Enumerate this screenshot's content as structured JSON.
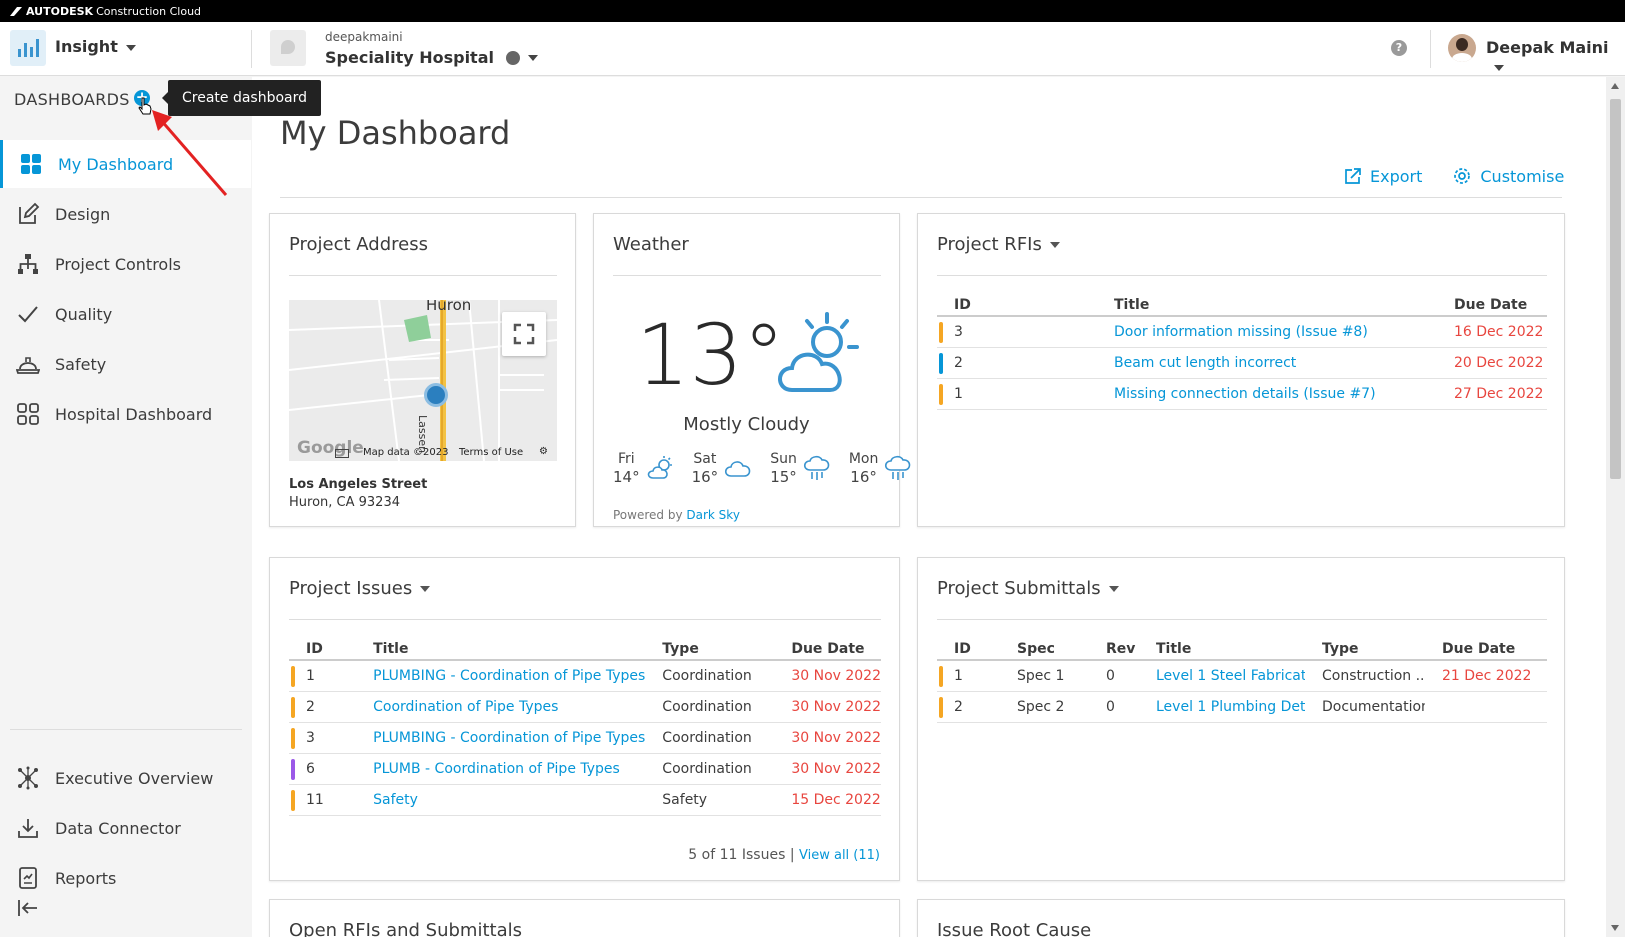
{
  "brand": {
    "company": "AUTODESK",
    "product": "Construction Cloud"
  },
  "app": {
    "name": "Insight"
  },
  "project": {
    "account": "deepakmaini",
    "name": "Speciality Hospital"
  },
  "user": {
    "name": "Deepak Maini"
  },
  "sidebar": {
    "header": "DASHBOARDS",
    "tooltip": "Create dashboard",
    "items": [
      {
        "label": "My Dashboard",
        "icon": "grid-icon"
      },
      {
        "label": "Design",
        "icon": "edit-icon"
      },
      {
        "label": "Project Controls",
        "icon": "hierarchy-icon"
      },
      {
        "label": "Quality",
        "icon": "check-icon"
      },
      {
        "label": "Safety",
        "icon": "hardhat-icon"
      },
      {
        "label": "Hospital Dashboard",
        "icon": "dashboard-squares-icon"
      }
    ],
    "bottom_items": [
      {
        "label": "Executive Overview",
        "icon": "network-icon"
      },
      {
        "label": "Data Connector",
        "icon": "download-icon"
      },
      {
        "label": "Reports",
        "icon": "report-icon"
      }
    ]
  },
  "page": {
    "title": "My Dashboard",
    "export_label": "Export",
    "customise_label": "Customise"
  },
  "address_card": {
    "title": "Project Address",
    "map": {
      "town_label": "Huron",
      "street_label": "Lassen",
      "google": "Google",
      "data": "Map data ©2023",
      "terms": "Terms of Use"
    },
    "line1": "Los Angeles Street",
    "line2": "Huron, CA 93234"
  },
  "weather_card": {
    "title": "Weather",
    "temp": "13°",
    "summary": "Mostly Cloudy",
    "forecast": [
      {
        "day": "Fri",
        "temp": "14°",
        "icon": "partly-cloudy-icon"
      },
      {
        "day": "Sat",
        "temp": "16°",
        "icon": "cloud-icon"
      },
      {
        "day": "Sun",
        "temp": "15°",
        "icon": "rain-icon"
      },
      {
        "day": "Mon",
        "temp": "16°",
        "icon": "rain-icon"
      }
    ],
    "powered_prefix": "Powered by",
    "powered_link": "Dark Sky"
  },
  "rfis_card": {
    "title": "Project RFIs",
    "columns": [
      "ID",
      "Title",
      "Due Date"
    ],
    "rows": [
      {
        "id": "3",
        "title": "Door information missing (Issue #8)",
        "due": "16 Dec 2022",
        "bar": "#f5a623"
      },
      {
        "id": "2",
        "title": "Beam cut length incorrect",
        "due": "20 Dec 2022",
        "bar": "#0696d7"
      },
      {
        "id": "1",
        "title": "Missing connection details (Issue #7)",
        "due": "27 Dec 2022",
        "bar": "#f5a623"
      }
    ]
  },
  "issues_card": {
    "title": "Project Issues",
    "columns": [
      "ID",
      "Title",
      "Type",
      "Due Date"
    ],
    "rows": [
      {
        "id": "1",
        "title": "PLUMBING - Coordination of Pipe Types",
        "type": "Coordination",
        "due": "30 Nov 2022",
        "bar": "#f5a623"
      },
      {
        "id": "2",
        "title": "Coordination of Pipe Types",
        "type": "Coordination",
        "due": "30 Nov 2022",
        "bar": "#f5a623"
      },
      {
        "id": "3",
        "title": "PLUMBING - Coordination of Pipe Types",
        "type": "Coordination",
        "due": "30 Nov 2022",
        "bar": "#f5a623"
      },
      {
        "id": "6",
        "title": "PLUMB - Coordination of Pipe Types",
        "type": "Coordination",
        "due": "30 Nov 2022",
        "bar": "#9b59e8"
      },
      {
        "id": "11",
        "title": "Safety",
        "type": "Safety",
        "due": "15 Dec 2022",
        "bar": "#f5a623"
      }
    ],
    "footer_count": "5 of 11 Issues",
    "footer_link": "View all (11)"
  },
  "submittals_card": {
    "title": "Project Submittals",
    "columns": [
      "ID",
      "Spec",
      "Rev",
      "Title",
      "Type",
      "Due Date"
    ],
    "rows": [
      {
        "id": "1",
        "spec": "Spec 1",
        "rev": "0",
        "title": "Level 1 Steel Fabricat...",
        "type": "Construction ...",
        "due": "21 Dec 2022",
        "bar": "#f5a623"
      },
      {
        "id": "2",
        "spec": "Spec 2",
        "rev": "0",
        "title": "Level 1 Plumbing Det...",
        "type": "Documentation",
        "due": "",
        "bar": "#f5a623"
      }
    ]
  },
  "lower_cards": {
    "left_title": "Open RFIs and Submittals",
    "right_title": "Issue Root Cause"
  },
  "colors": {
    "accent": "#0696d7",
    "overdue": "#e8463f"
  }
}
